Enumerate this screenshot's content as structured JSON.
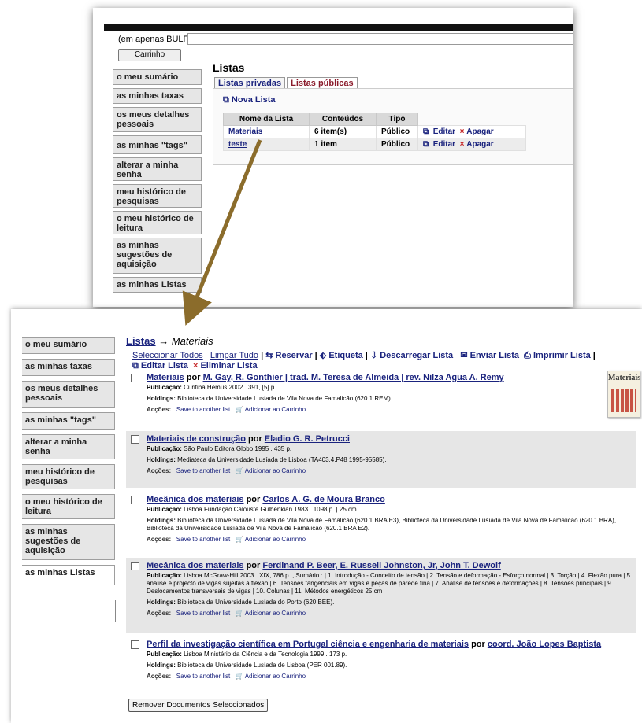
{
  "top": {
    "bulf_label": "(em apenas BULF)",
    "carrinho_label": "Carrinho",
    "sidebar": [
      "o meu sumário",
      "as minhas taxas",
      "os meus detalhes pessoais",
      "as minhas \"tags\"",
      "alterar a minha senha",
      "meu histórico de pesquisas",
      "o meu histórico de leitura",
      "as minhas sugestões de aquisição",
      "as minhas Listas"
    ],
    "title": "Listas",
    "tabs": [
      "Listas privadas",
      "Listas públicas"
    ],
    "nova_lista": "Nova Lista",
    "table": {
      "headers": [
        "Nome da Lista",
        "Conteúdos",
        "Tipo"
      ],
      "rows": [
        {
          "name": "Materiais",
          "contents": "6 item(s)",
          "type": "Público",
          "edit": "Editar",
          "delete": "Apagar"
        },
        {
          "name": "teste",
          "contents": "1 item",
          "type": "Público",
          "edit": "Editar",
          "delete": "Apagar"
        }
      ]
    }
  },
  "bottom": {
    "sidebar": [
      "o meu sumário",
      "as minhas taxas",
      "os meus detalhes pessoais",
      "as minhas \"tags\"",
      "alterar a minha senha",
      "meu histórico de pesquisas",
      "o meu histórico de leitura",
      "as minhas sugestões de aquisição",
      "as minhas Listas"
    ],
    "breadcrumb": {
      "root": "Listas",
      "sep": "→",
      "current": "Materiais"
    },
    "actions": {
      "select_all": "Seleccionar Todos",
      "clear_all": "Limpar Tudo",
      "reserve": "Reservar",
      "tag": "Etiqueta",
      "download": "Descarregar Lista",
      "send": "Enviar Lista",
      "print": "Imprimir Lista",
      "edit": "Editar Lista",
      "delete": "Eliminar Lista"
    },
    "labels": {
      "por": "por",
      "publicacao": "Publicação:",
      "holdings": "Holdings:",
      "accoes": "Acções:",
      "save_other": "Save to another list",
      "add_cart": "Adicionar ao Carrinho"
    },
    "records": [
      {
        "title": "Materiais",
        "author": "M. Gay, R. Gonthier | trad. M. Teresa de Almeida | rev. Nilza Agua A. Remy",
        "publication": "Curitiba Hemus 2002 . 391, [5] p.",
        "holdings": "Biblioteca da Universidade Lusíada de Vila Nova de Famalicão (620.1 REM)."
      },
      {
        "title": "Materiais de construção",
        "author": "Eladio G. R. Petrucci",
        "publication": "São Paulo Editora Globo 1995 . 435 p.",
        "holdings": "Mediateca da Universidade Lusíada de Lisboa (TA403.4.P48 1995-95585)."
      },
      {
        "title": "Mecânica dos materiais",
        "author": "Carlos A. G. de Moura Branco",
        "publication": "Lisboa Fundação Calouste Gulbenkian 1983 . 1098 p. | 25 cm",
        "holdings": "Biblioteca da Universidade Lusíada de Vila Nova de Famalicão (620.1 BRA E3), Biblioteca da Universidade Lusíada de Vila Nova de Famalicão (620.1 BRA), Biblioteca da Universidade Lusíada de Vila Nova de Famalicão (620.1 BRA E2)."
      },
      {
        "title": "Mecânica dos materiais",
        "author": "Ferdinand P. Beer, E. Russell Johnston, Jr, John T. Dewolf",
        "publication": "Lisboa McGraw-Hill 2003 . XIX, 786 p. , Sumário : | 1. Introdução - Conceito de tensão | 2. Tensão e deformação - Esforço normal | 3. Torção | 4. Flexão pura | 5. análise e projecto de vigas sujeitas à flexão | 6. Tensões tangenciais em vigas e peças de parede fina | 7. Análise de tensões e deformações | 8. Tensões principais | 9. Deslocamentos transversais de vigas | 10. Colunas | 11. Métodos energéticos 25 cm",
        "holdings": "Biblioteca da Universidade Lusíada do Porto (620 BEE)."
      },
      {
        "title": "Perfil da investigação científica em Portugal ciência e engenharia de materiais",
        "author": "coord. João Lopes Baptista",
        "publication": "Lisboa Ministério da Ciência e da Tecnologia 1999 . 173 p.",
        "holdings": "Biblioteca da Universidade Lusíada de Lisboa (PER 001.89)."
      }
    ],
    "cover_text": "Materiais",
    "remove_button": "Remover Documentos Seleccionados"
  }
}
